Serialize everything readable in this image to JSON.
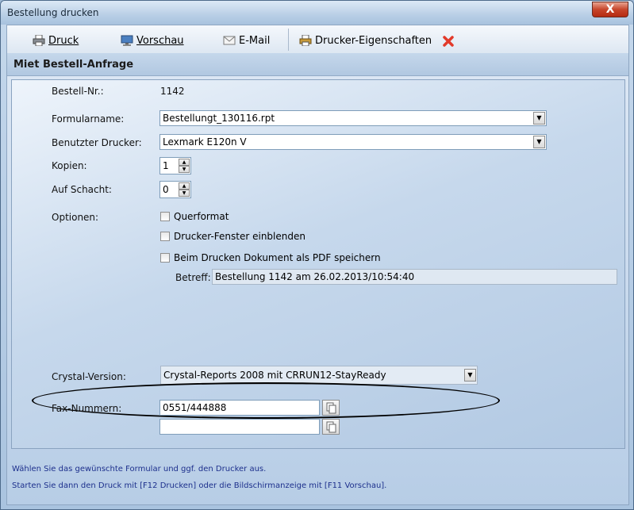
{
  "window": {
    "title": "Bestellung drucken",
    "close_symbol": "X"
  },
  "toolbar": {
    "print_label": "Druck",
    "preview_label": "Vorschau",
    "email_label": "E-Mail",
    "printer_props_label": "Drucker-Eigenschaften",
    "icons": [
      "printer-icon",
      "monitor-icon",
      "envelope-icon",
      "printer-settings-icon",
      "red-x-icon"
    ]
  },
  "header": {
    "title": "Miet Bestell-Anfrage"
  },
  "form": {
    "order_no_label": "Bestell-Nr.:",
    "order_no_value": "1142",
    "form_name_label": "Formularname:",
    "form_name_value": "Bestellungt_130116.rpt",
    "printer_label": "Benutzter Drucker:",
    "printer_value": "Lexmark E120n V",
    "copies_label": "Kopien:",
    "copies_value": "1",
    "tray_label": "Auf Schacht:",
    "tray_value": "0",
    "options_label": "Optionen:",
    "options": [
      {
        "label": "Querformat",
        "checked": false
      },
      {
        "label": "Drucker-Fenster einblenden",
        "checked": false
      },
      {
        "label": "Beim Drucken Dokument als PDF speichern",
        "checked": false
      }
    ],
    "subject_label": "Betreff:",
    "subject_value": "Bestellung 1142 am 26.02.2013/10:54:40",
    "crystal_label": "Crystal-Version:",
    "crystal_value": "Crystal-Reports 2008 mit CRRUN12-StayReady",
    "fax_label": "Fax-Nummern:",
    "fax_values": [
      "0551/444888",
      ""
    ]
  },
  "status": {
    "line1": "Wählen Sie das gewünschte Formular und ggf. den Drucker aus.",
    "line2": "Starten Sie dann den Druck mit [F12 Drucken] oder die Bildschirmanzeige mit [F11 Vorschau]."
  },
  "colors": {
    "accent": "#1c2f8c",
    "close": "#c7452b",
    "panel": "#c6d8ec"
  }
}
